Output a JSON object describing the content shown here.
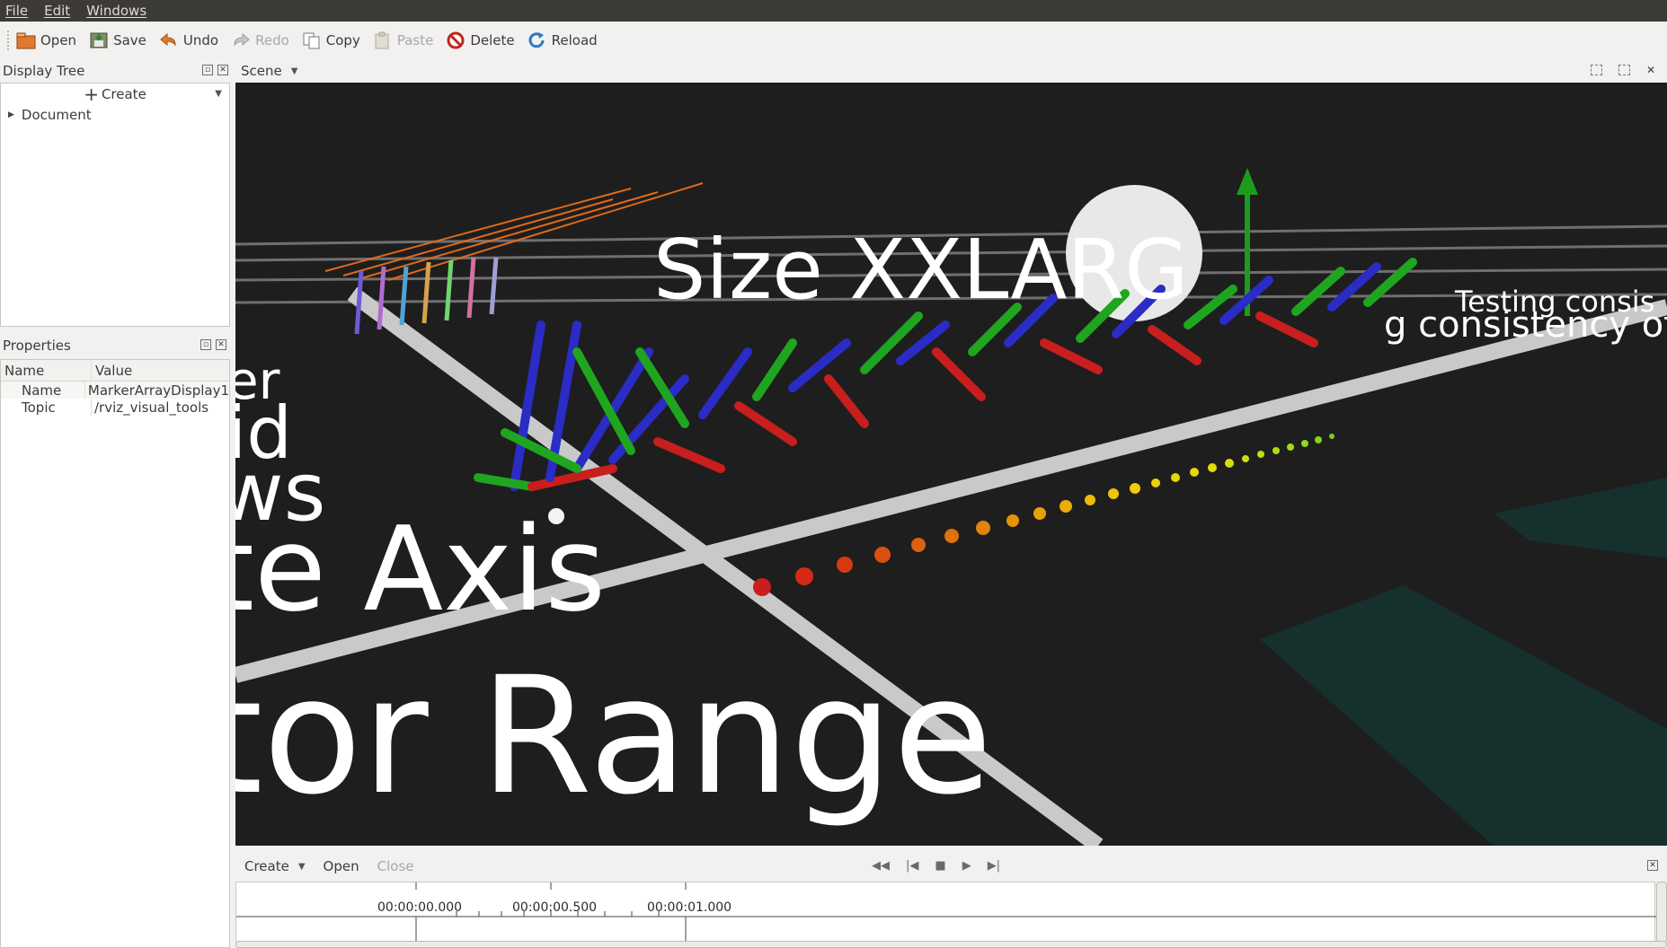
{
  "menu": {
    "file": "File",
    "edit": "Edit",
    "windows": "Windows"
  },
  "toolbar": {
    "open": "Open",
    "save": "Save",
    "undo": "Undo",
    "redo": "Redo",
    "copy": "Copy",
    "paste": "Paste",
    "delete": "Delete",
    "reload": "Reload"
  },
  "display_tree": {
    "title": "Display Tree",
    "create_label": "Create",
    "items": [
      {
        "label": "Document"
      }
    ]
  },
  "properties": {
    "title": "Properties",
    "headers": {
      "name": "Name",
      "value": "Value"
    },
    "rows": [
      {
        "name": "Name",
        "value": "MarkerArrayDisplay1"
      },
      {
        "name": "Topic",
        "value": "/rviz_visual_tools"
      }
    ]
  },
  "scene": {
    "title": "Scene",
    "overlay_text": {
      "range": "tor Range",
      "axis": "te Axis",
      "ws": "ws",
      "id": "id",
      "er": "er",
      "size": "Size XXLARG",
      "testing1": "Testing consis",
      "testing2": "g consistency of"
    }
  },
  "timeline": {
    "create": "Create",
    "open": "Open",
    "close": "Close",
    "ticks": [
      "00:00:00.000",
      "00:00:00.500",
      "00:00:01.000"
    ]
  },
  "colors": {
    "menubar": "#3c3b37",
    "viewport": "#1e1e1e",
    "panel": "#f2f1f0"
  }
}
